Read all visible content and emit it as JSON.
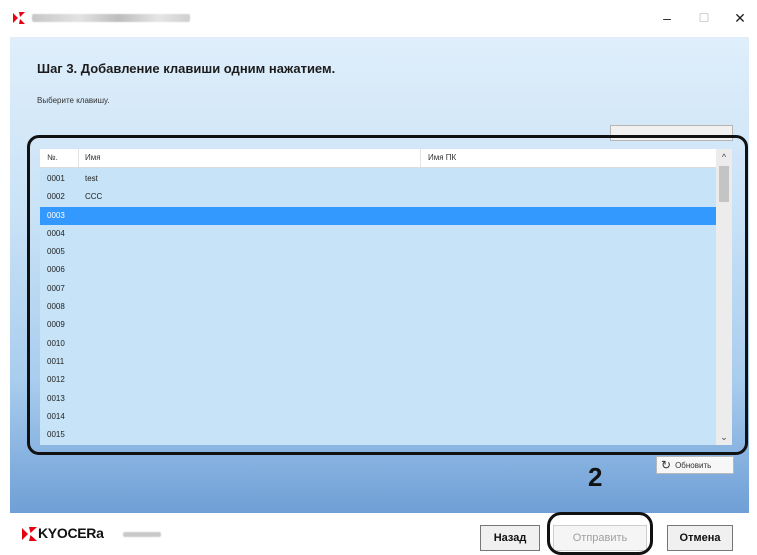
{
  "window": {
    "minimize_glyph": "–",
    "maximize_glyph": "☐",
    "close_glyph": "✕"
  },
  "dialog": {
    "step_title": "Шаг 3. Добавление клавиши одним нажатием.",
    "instruction": "Выберите клавишу."
  },
  "table": {
    "columns": [
      "№.",
      "Имя",
      "Имя ПК"
    ],
    "selected_row": "0003",
    "rows": [
      {
        "no": "0001",
        "name": "test",
        "pc": ""
      },
      {
        "no": "0002",
        "name": "CCC",
        "pc": ""
      },
      {
        "no": "0003",
        "name": "",
        "pc": ""
      },
      {
        "no": "0004",
        "name": "",
        "pc": ""
      },
      {
        "no": "0005",
        "name": "",
        "pc": ""
      },
      {
        "no": "0006",
        "name": "",
        "pc": ""
      },
      {
        "no": "0007",
        "name": "",
        "pc": ""
      },
      {
        "no": "0008",
        "name": "",
        "pc": ""
      },
      {
        "no": "0009",
        "name": "",
        "pc": ""
      },
      {
        "no": "0010",
        "name": "",
        "pc": ""
      },
      {
        "no": "0011",
        "name": "",
        "pc": ""
      },
      {
        "no": "0012",
        "name": "",
        "pc": ""
      },
      {
        "no": "0013",
        "name": "",
        "pc": ""
      },
      {
        "no": "0014",
        "name": "",
        "pc": ""
      },
      {
        "no": "0015",
        "name": "",
        "pc": ""
      }
    ]
  },
  "refresh_button": {
    "label": "Обновить",
    "icon": "refresh-icon"
  },
  "callout": {
    "number": "2"
  },
  "footer": {
    "brand": "KYOCERa",
    "back_label": "Назад",
    "send_label": "Отправить",
    "cancel_label": "Отмена"
  },
  "colors": {
    "selection": "#3399ff",
    "grid_background": "#c6e3f7",
    "brand_red": "#e60012"
  }
}
